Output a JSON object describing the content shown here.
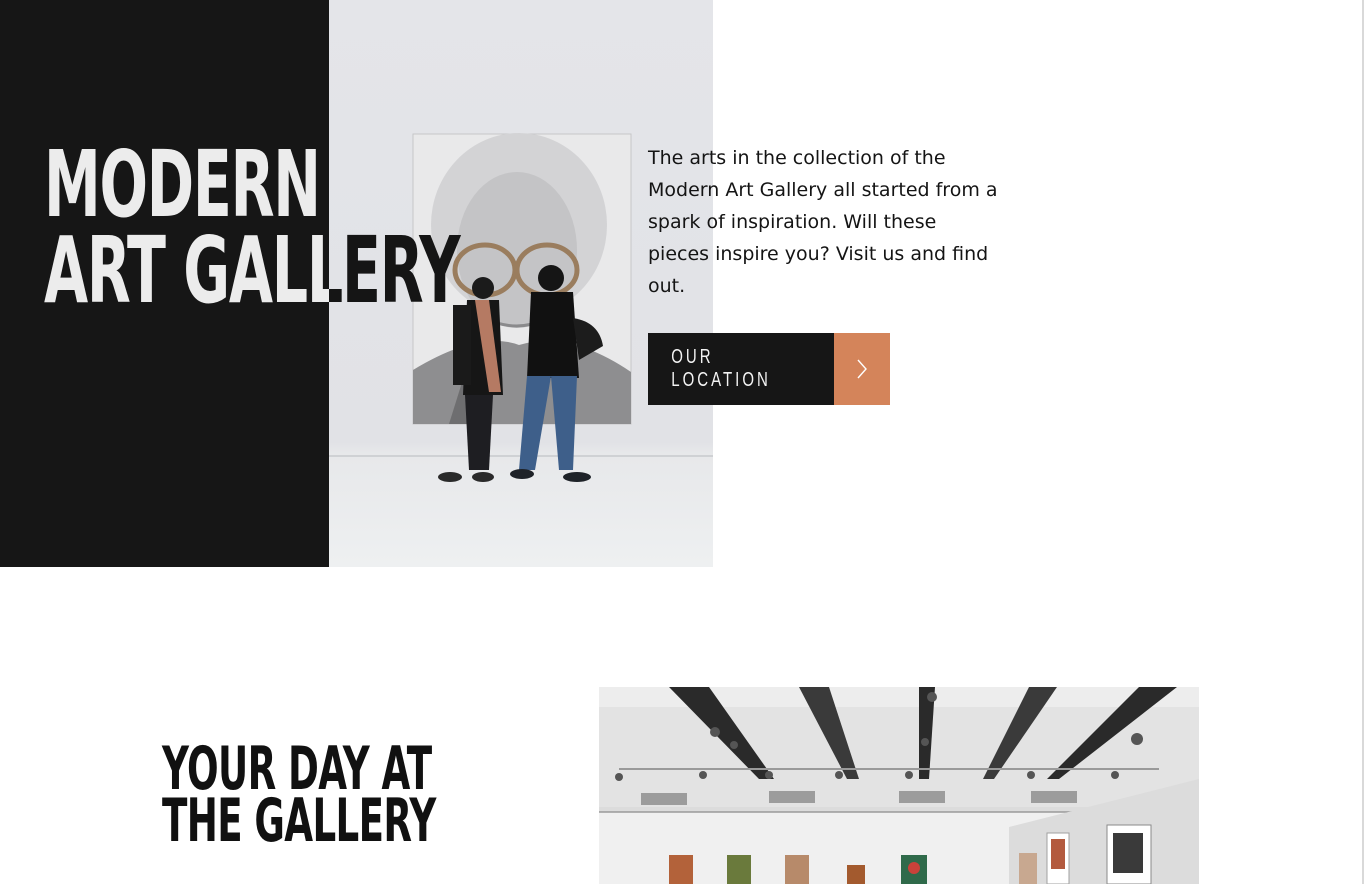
{
  "hero": {
    "title_line1": "MODERN",
    "title_line2": "ART GALLERY",
    "description": "The arts in the collection of the Modern Art Gallery all started from a spark of inspiration. Will these pieces inspire you? Visit us and find out.",
    "cta_label": "OUR LOCATION",
    "cta_icon": "chevron-right-icon",
    "photo_alt": "two visitors looking at a large portrait painting"
  },
  "section2": {
    "title_line1": "YOUR DAY AT",
    "title_line2": "THE GALLERY",
    "photo_alt": "gallery interior with artworks on walls"
  },
  "colors": {
    "dark": "#161616",
    "accent": "#d4845a",
    "light_text": "#ececec",
    "background": "#ffffff"
  }
}
